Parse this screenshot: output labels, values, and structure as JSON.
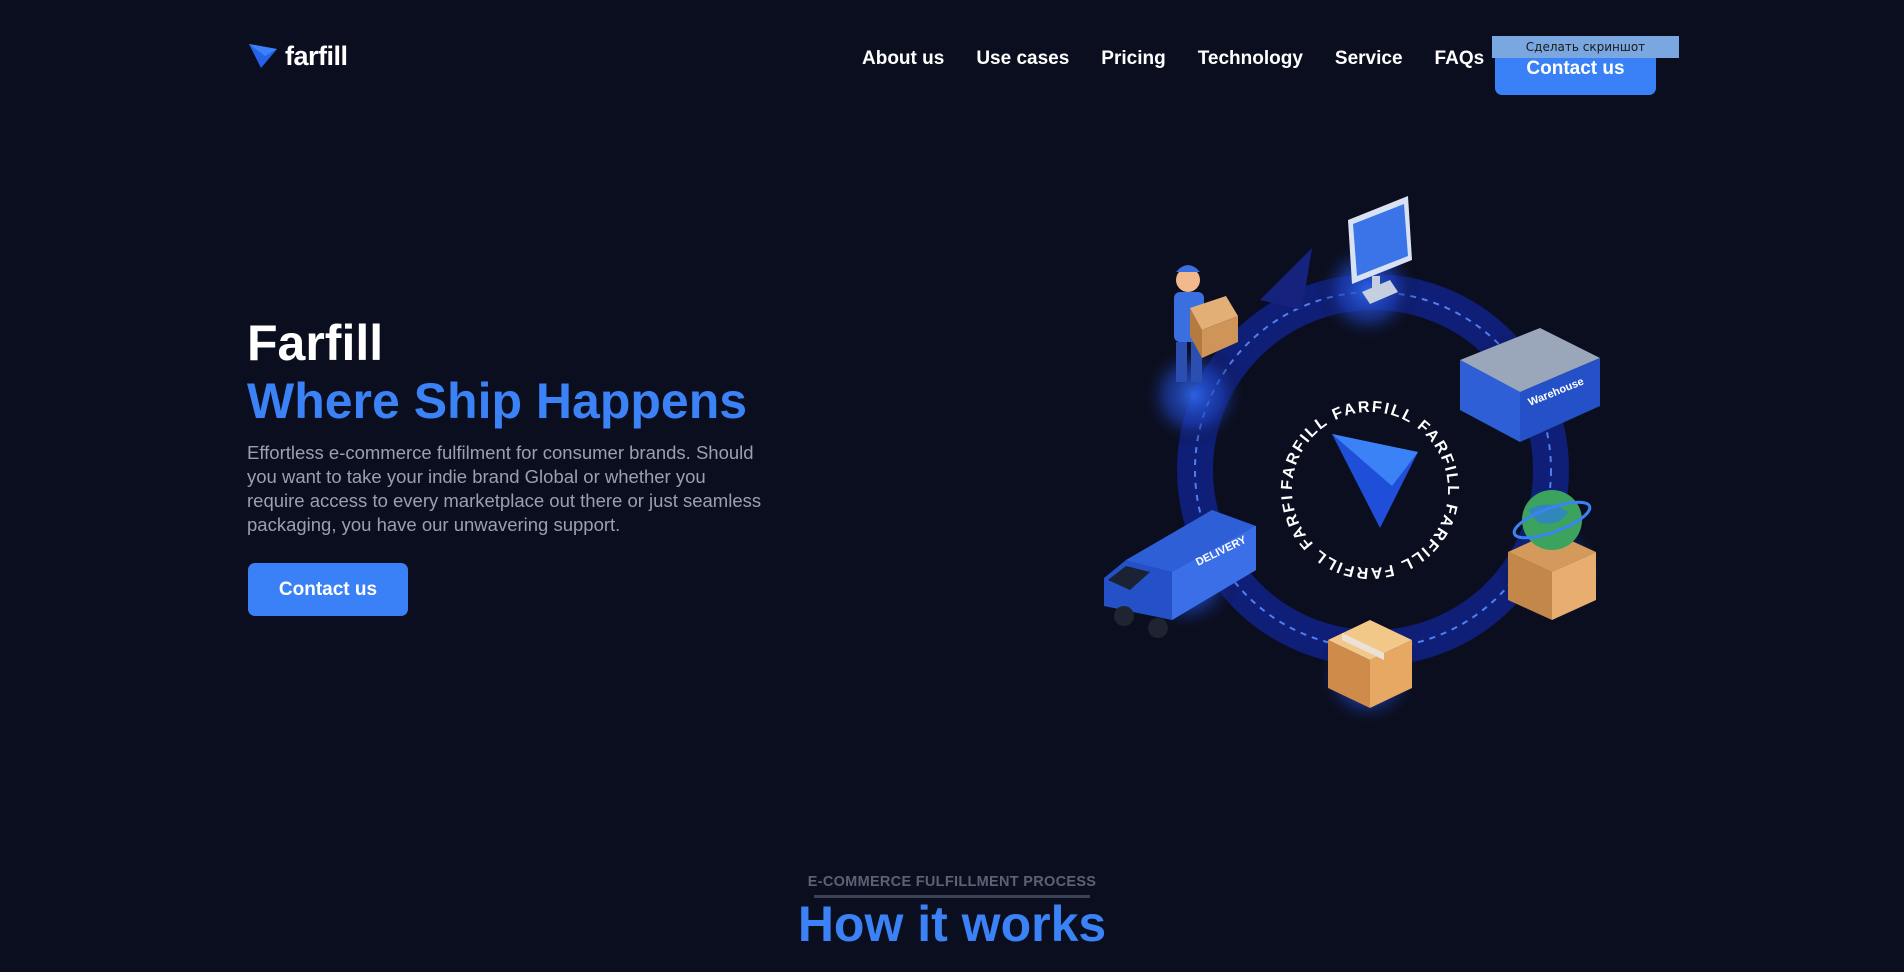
{
  "header": {
    "logo_text": "farfill",
    "nav": [
      "About us",
      "Use cases",
      "Pricing",
      "Technology",
      "Service",
      "FAQs"
    ],
    "contact_label": "Contact us",
    "screenshot_badge": "Сделать скриншот"
  },
  "hero": {
    "title": "Farfill",
    "subtitle": "Where Ship Happens",
    "description": "Effortless e-commerce fulfilment for consumer brands. Should you want to take your indie brand Global or whether you require access to every marketplace out there or just seamless packaging, you have our unwavering support.",
    "cta_label": "Contact us"
  },
  "illustration": {
    "ring_text": "FARFILL FARFILL FARFILL FARFILL FARFILL FARFILL",
    "van_label": "DELIVERY",
    "warehouse_label": "Warehouse",
    "icons": [
      "worker-icon",
      "computer-icon",
      "warehouse-icon",
      "globe-box-icon",
      "package-icon",
      "delivery-van-icon"
    ]
  },
  "how_it_works": {
    "eyebrow": "E-COMMERCE FULFILLMENT PROCESS",
    "title": "How it works",
    "subtitle": ""
  },
  "colors": {
    "background": "#0b0e1e",
    "accent": "#3b82f6",
    "button": "#3a80f6",
    "muted_text": "#9aa0ae"
  }
}
